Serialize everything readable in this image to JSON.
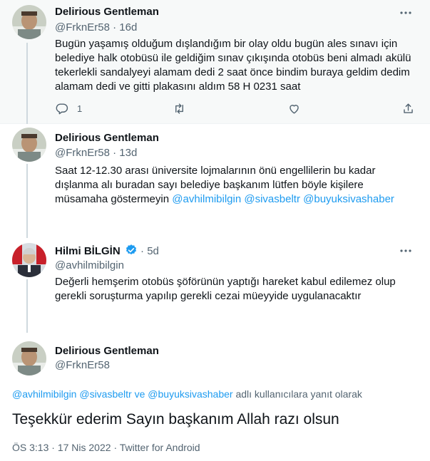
{
  "tweets": [
    {
      "name": "Delirious Gentleman",
      "handle": "@FrknEr58",
      "time": "16d",
      "text": "Bugün yaşamış olduğum dışlandığım bir olay oldu  bugün ales sınavı için belediye halk otobüsü ile geldiğim sınav çıkışında otobüs beni almadı akülü tekerlekli sandalyeyi alamam dedi 2 saat önce bindim buraya geldim dedim alamam dedi ve gitti plakasını aldım 58 H 0231 saat",
      "reply_count": "1"
    },
    {
      "name": "Delirious Gentleman",
      "handle": "@FrknEr58",
      "time": "13d",
      "text": "Saat 12-12.30 arası üniversite lojmalarının önü engellilerin bu kadar dışlanma alı buradan sayı belediye başkanım lütfen böyle kişilere müsamaha göstermeyin",
      "mentions": [
        "@avhilmibilgin",
        "@sivasbeltr",
        "@buyuksivashaber"
      ]
    },
    {
      "name": "Hilmi BİLGİN",
      "handle": "@avhilmibilgin",
      "time": "5d",
      "text": "Değerli hemşerim otobüs şöförünün yaptığı hareket kabul edilemez olup gerekli soruşturma yapılıp gerekli cezai müeyyide uygulanacaktır"
    }
  ],
  "main": {
    "name": "Delirious Gentleman",
    "handle": "@FrknEr58",
    "reply_mention_1": "@avhilmibilgin",
    "reply_mention_2": "@sivasbeltr",
    "reply_and": "ve",
    "reply_mention_3": "@buyuksivashaber",
    "reply_suffix": "adlı kullanıcılara yanıt olarak",
    "text": "Teşekkür ederim Sayın başkanım Allah razı olsun",
    "time": "ÖS 3:13",
    "date": "17 Nis 2022",
    "source": "Twitter for Android",
    "dot": "·"
  },
  "colors": {
    "accent": "#1d9bf0",
    "secondary_text": "#536471",
    "highlight_bg": "#f7f9f9"
  },
  "icons": {
    "more": "more-horizontal-icon",
    "reply": "reply-icon",
    "retweet": "retweet-icon",
    "like": "like-icon",
    "share": "share-icon",
    "verified": "verified-badge-icon"
  }
}
